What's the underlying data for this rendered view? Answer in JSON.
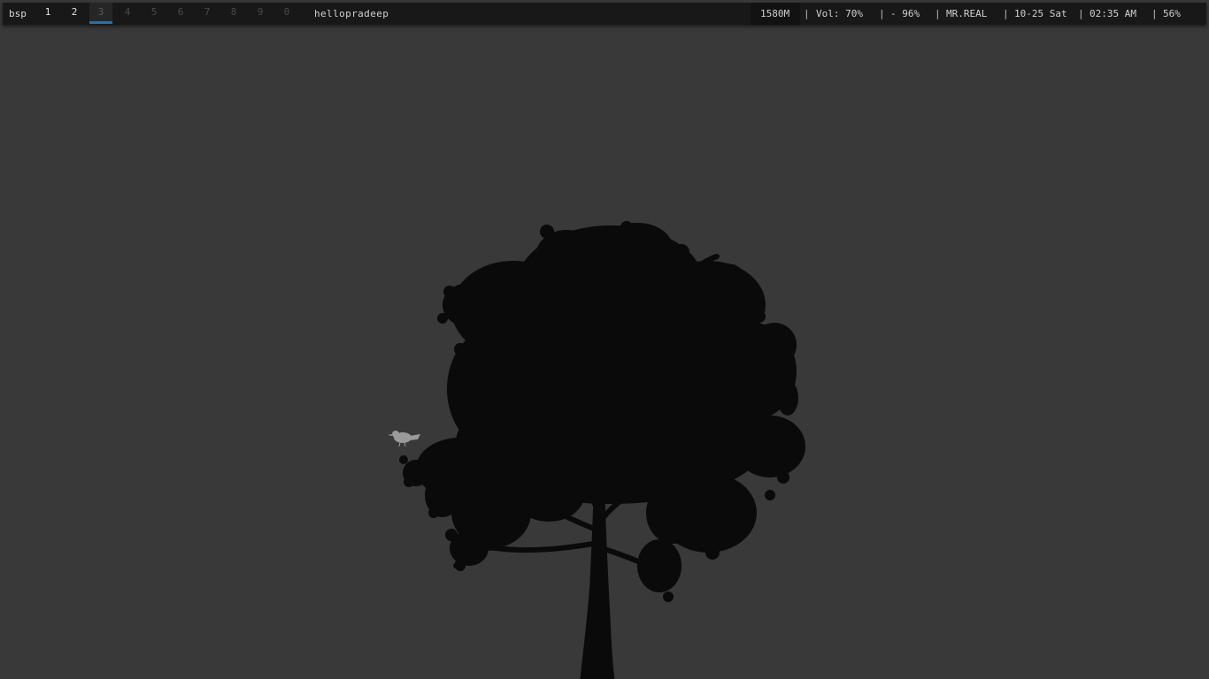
{
  "topbar": {
    "layout": "bsp",
    "workspaces": [
      {
        "label": "1",
        "state": "occupied"
      },
      {
        "label": "2",
        "state": "occupied"
      },
      {
        "label": "3",
        "state": "focused"
      },
      {
        "label": "4",
        "state": "empty"
      },
      {
        "label": "5",
        "state": "empty"
      },
      {
        "label": "6",
        "state": "empty"
      },
      {
        "label": "7",
        "state": "empty"
      },
      {
        "label": "8",
        "state": "empty"
      },
      {
        "label": "9",
        "state": "empty"
      },
      {
        "label": "0",
        "state": "empty"
      }
    ],
    "window_title": "hellopradeep",
    "status": {
      "memory": "1580M",
      "volume": "Vol: 70%",
      "battery": "- 96%",
      "network": "MR.REAL",
      "date": "10-25 Sat",
      "time": "02:35 AM",
      "brightness": "56%"
    },
    "separator": "|"
  },
  "colors": {
    "desktop_bg": "#393939",
    "bar_bg": "#181818",
    "focus_accent": "#2f6e9c",
    "tree": "#0a0a0a",
    "bird": "#9a9a9a"
  }
}
